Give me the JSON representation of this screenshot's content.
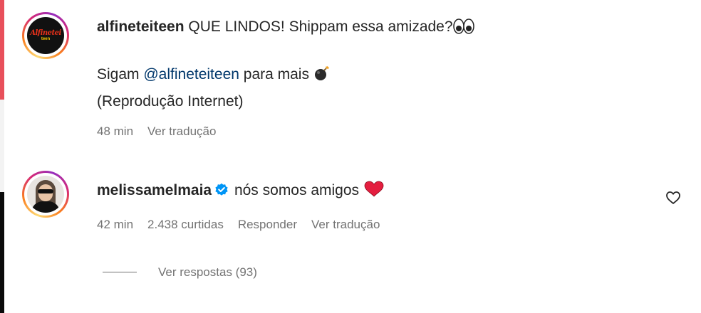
{
  "comments": [
    {
      "username": "alfineteiteen",
      "avatar_icon": "alfineteiteen-logo",
      "avatar_logo_text": "Alfinetei",
      "avatar_logo_sub": "teen",
      "text": " QUE LINDOS! Shippam essa amizade?",
      "text_emoji": "eyes-emoji",
      "body_line1_prefix": "Sigam ",
      "body_mention": "@alfineteiteen",
      "body_line1_suffix": " para mais ",
      "body_emoji": "bomb-emoji",
      "body_line2": "(Reprodução Internet)",
      "time": "48 min",
      "translate": "Ver tradução"
    },
    {
      "username": "melissamelmaia",
      "avatar_icon": "profile-photo",
      "verified_icon": "verified-badge-icon",
      "text": " nós somos amigos ",
      "text_emoji": "red-heart-emoji",
      "time": "42 min",
      "likes": "2.438 curtidas",
      "reply": "Responder",
      "translate": "Ver tradução",
      "like_icon": "heart-outline-icon",
      "replies_label": "Ver respostas (93)"
    }
  ],
  "colors": {
    "text": "#262626",
    "secondary": "#737373",
    "link": "#00376b",
    "verified": "#0095f6",
    "heart": "#e41e3f"
  }
}
